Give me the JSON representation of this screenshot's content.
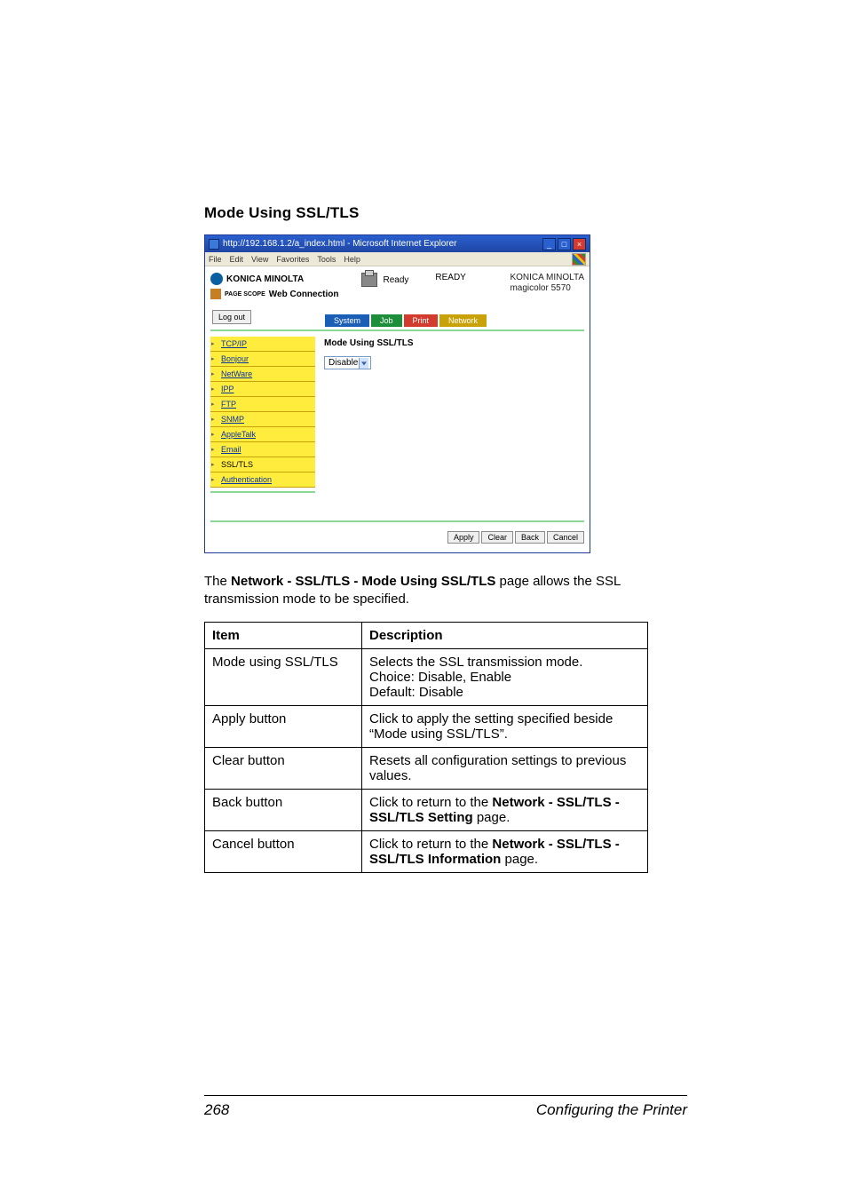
{
  "section_heading": "Mode Using SSL/TLS",
  "screenshot": {
    "window_title": "http://192.168.1.2/a_index.html - Microsoft Internet Explorer",
    "menu": [
      "File",
      "Edit",
      "View",
      "Favorites",
      "Tools",
      "Help"
    ],
    "brand": "KONICA MINOLTA",
    "pagescope_prefix": "PAGE SCOPE",
    "web_connection": "Web Connection",
    "ready_label": "Ready",
    "status": "READY",
    "owner_line1": "KONICA MINOLTA",
    "owner_line2": "magicolor 5570",
    "logout_btn": "Log out",
    "tabs": {
      "system": "System",
      "job": "Job",
      "print": "Print",
      "network": "Network"
    },
    "sidebar": [
      "TCP/IP",
      "Bonjour",
      "NetWare",
      "IPP",
      "FTP",
      "SNMP",
      "AppleTalk",
      "Email",
      "SSL/TLS",
      "Authentication"
    ],
    "content_heading": "Mode Using SSL/TLS",
    "select_value": "Disable",
    "buttons": {
      "apply": "Apply",
      "clear": "Clear",
      "back": "Back",
      "cancel": "Cancel"
    }
  },
  "body_paragraph_prefix": "The ",
  "body_paragraph_bold": "Network - SSL/TLS - Mode Using SSL/TLS",
  "body_paragraph_suffix": " page allows the SSL transmission mode to be specified.",
  "table": {
    "header_item": "Item",
    "header_desc": "Description",
    "rows": [
      {
        "item": "Mode using SSL/TLS",
        "desc_line1": "Selects the SSL transmission mode.",
        "desc_line2": "Choice:  Disable, Enable",
        "desc_line3": "Default:  Disable"
      },
      {
        "item": "Apply button",
        "desc_line1": "Click to apply the setting specified beside “Mode using SSL/TLS”."
      },
      {
        "item": "Clear button",
        "desc_line1": "Resets all configuration settings to previous values."
      },
      {
        "item": "Back button",
        "desc_prefix": "Click to return to the ",
        "desc_bold": "Network - SSL/TLS - SSL/TLS Setting",
        "desc_suffix": " page."
      },
      {
        "item": "Cancel button",
        "desc_prefix": "Click to return to the ",
        "desc_bold": "Network - SSL/TLS - SSL/TLS Information",
        "desc_suffix": " page."
      }
    ]
  },
  "footer": {
    "page_number": "268",
    "running_title": "Configuring the Printer"
  }
}
